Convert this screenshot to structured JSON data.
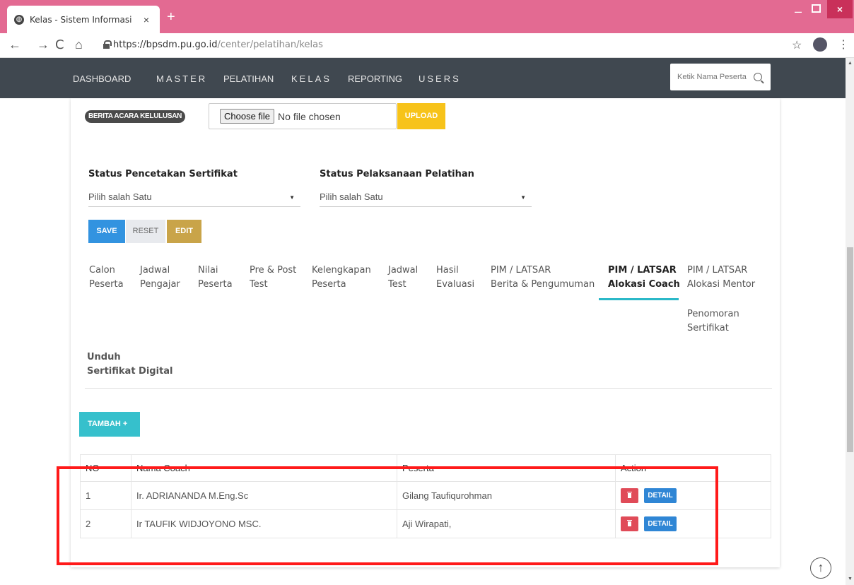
{
  "browser": {
    "tab_title": "Kelas - Sistem Informasi",
    "tab_close": "×",
    "new_tab": "+",
    "url_host": "https://bpsdm.pu.go.id",
    "url_path": "/center/pelatihan/kelas",
    "back": "←",
    "forward": "→",
    "reload": "C",
    "home": "⌂",
    "star": "☆",
    "menu": "⋮",
    "minimize": "–",
    "close": "×"
  },
  "nav": {
    "items": [
      "DASHBOARD",
      "MASTER",
      "PELATIHAN",
      "KELAS",
      "REPORTING",
      "USERS"
    ],
    "search_placeholder": "Ketik Nama Peserta"
  },
  "upload": {
    "badge": "BERITA ACARA KELULUSAN",
    "choose_file": "Choose file",
    "no_file": "No file chosen",
    "upload_label": "UPLOAD"
  },
  "form": {
    "status_cetak_label": "Status Pencetakan Sertifikat",
    "status_cetak_value": "Pilih salah Satu",
    "status_pelaksanaan_label": "Status Pelaksanaan Pelatihan",
    "status_pelaksanaan_value": "Pilih salah Satu",
    "save": "SAVE",
    "reset": "RESET",
    "edit": "EDIT"
  },
  "tabs": [
    {
      "line1": "Calon",
      "line2": "Peserta"
    },
    {
      "line1": "Jadwal",
      "line2": "Pengajar"
    },
    {
      "line1": "Nilai",
      "line2": "Peserta"
    },
    {
      "line1": "Pre & Post",
      "line2": "Test"
    },
    {
      "line1": "Kelengkapan",
      "line2": "Peserta"
    },
    {
      "line1": "Jadwal",
      "line2": "Test"
    },
    {
      "line1": "Hasil",
      "line2": "Evaluasi"
    },
    {
      "line1": "PIM / LATSAR",
      "line2": "Berita & Pengumuman"
    },
    {
      "line1": "PIM / LATSAR",
      "line2": "Alokasi Coach"
    },
    {
      "line1": "PIM / LATSAR",
      "line2": "Alokasi Mentor"
    },
    {
      "line1": "Penomoran",
      "line2": "Sertifikat"
    },
    {
      "line1": "Unduh",
      "line2": "Sertifikat Digital"
    }
  ],
  "active_tab": "PIM / LATSAR Alokasi Coach",
  "tambah_label": "TAMBAH +",
  "table": {
    "headers": [
      "NO",
      "Nama Coach",
      "Peserta",
      "Action"
    ],
    "rows": [
      {
        "no": "1",
        "nama": "Ir. ADRIANANDA M.Eng.Sc",
        "peserta": "Gilang Taufiqurohman"
      },
      {
        "no": "2",
        "nama": "Ir TAUFIK WIDJOYONO MSC.",
        "peserta": "Aji Wirapati,"
      }
    ],
    "detail_label": "DETAIL"
  },
  "colors": {
    "tabbar": "#e36a92",
    "nav": "#404850",
    "save": "#3293e0",
    "edit": "#c9a449",
    "upload": "#f7c31a",
    "tambah": "#36c0cc",
    "delete": "#e04b58",
    "detail": "#2f86d5",
    "highlight": "#ff1a1a"
  },
  "icons": {
    "scroll_top": "↑"
  }
}
